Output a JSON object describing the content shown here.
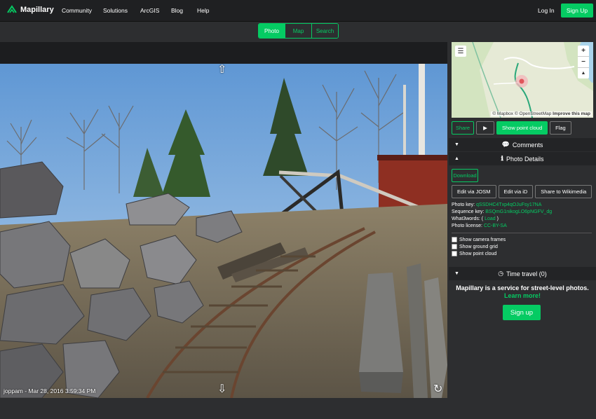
{
  "nav": {
    "logo_text": "Mapillary",
    "items": [
      "Community",
      "Solutions",
      "ArcGIS",
      "Blog",
      "Help"
    ],
    "login": "Log In",
    "signup": "Sign Up"
  },
  "tabs": [
    {
      "label": "Photo",
      "active": true
    },
    {
      "label": "Map",
      "active": false
    },
    {
      "label": "Search",
      "active": false
    }
  ],
  "viewer": {
    "caption": "joppam - Mar 28, 2016 3:59:34 PM",
    "nav_arrows": [
      "arrow-up-icon",
      "arrow-down-icon",
      "rotate-icon"
    ]
  },
  "map": {
    "menu_icon": "menu-icon",
    "zoom_in": "+",
    "zoom_out": "−",
    "compass": "▲",
    "attribution_mapbox": "© Mapbox",
    "attribution_osm": "© OpenStreetMap",
    "improve": "Improve this map"
  },
  "actions": {
    "share": "Share",
    "play_icon": "▶",
    "point_cloud": "Show point cloud",
    "flag": "Flag"
  },
  "comments": {
    "title": "Comments",
    "icon": "comment-icon"
  },
  "photo_details": {
    "title": "Photo Details",
    "icon": "info-icon",
    "download": "Download",
    "edit_josm": "Edit via JOSM",
    "edit_id": "Edit via iD",
    "share_wikimedia": "Share to Wikimedia",
    "photo_key_label": "Photo key:",
    "photo_key": "qSSDHC4Txp4qOJuFsy17NA",
    "sequence_key_label": "Sequence key:",
    "sequence_key": "BSQmG1nikogLO6pNGFV_dg",
    "what3words_label": "What3words: (",
    "what3words_link": "Load",
    "what3words_close": ")",
    "license_label": "Photo license:",
    "license": "CC-BY-SA",
    "checkboxes": [
      "Show camera frames",
      "Show ground grid",
      "Show point cloud"
    ]
  },
  "time_travel": {
    "title": "Time travel (0)",
    "icon": "clock-icon"
  },
  "promo": {
    "text": "Mapillary is a service for street-level photos.",
    "link": "Learn more!",
    "signup": "Sign up"
  },
  "colors": {
    "accent": "#05cb63",
    "background": "#2d2e30",
    "navbar": "#1f2022"
  }
}
